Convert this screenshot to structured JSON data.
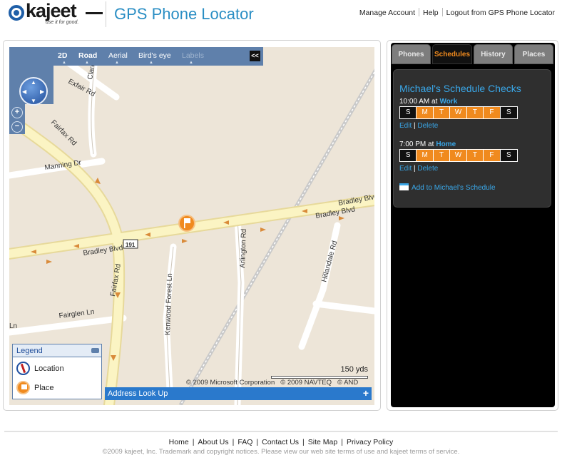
{
  "brand": {
    "logo_word": "kajeet",
    "logo_tagline": "use it for good.",
    "app_title": "GPS Phone Locator"
  },
  "top_links": [
    "Manage Account",
    "Help",
    "Logout from GPS Phone Locator"
  ],
  "map": {
    "toolbar": {
      "mode_2d": "2D",
      "road": "Road",
      "aerial": "Aerial",
      "birds_eye": "Bird's eye",
      "labels": "Labels",
      "collapse": "<<"
    },
    "street_labels": [
      "Exfair Rd",
      "Clarendon",
      "Fairfax Rd",
      "Manning Dr",
      "Bradley Blvd",
      "Bradley Blvd",
      "Bradley Blvd",
      "191",
      "Arlington Rd",
      "Hillandale Rd",
      "Fairfax Rd",
      "Kenwood Forest Ln",
      "Fairglen Ln",
      "Ln"
    ],
    "legend": {
      "title": "Legend",
      "items": [
        {
          "label": "Location",
          "icon": "location-marker-icon"
        },
        {
          "label": "Place",
          "icon": "place-flag-icon"
        }
      ]
    },
    "scale_label": "150 yds",
    "copyright": [
      "© 2009 Microsoft Corporation",
      "© 2009 NAVTEQ",
      "© AND"
    ],
    "address_lookup": "Address Look Up",
    "address_plus": "+"
  },
  "side": {
    "tabs": [
      {
        "label": "Phones",
        "active": false
      },
      {
        "label": "Schedules",
        "active": true
      },
      {
        "label": "History",
        "active": false
      },
      {
        "label": "Places",
        "active": false
      }
    ],
    "title": "Michael's Schedule Checks",
    "entries": [
      {
        "time": "10:00 AM at",
        "place": "Work",
        "days": [
          {
            "d": "S",
            "on": false
          },
          {
            "d": "M",
            "on": true
          },
          {
            "d": "T",
            "on": true
          },
          {
            "d": "W",
            "on": true
          },
          {
            "d": "T",
            "on": true
          },
          {
            "d": "F",
            "on": true
          },
          {
            "d": "S",
            "on": false
          }
        ],
        "edit": "Edit",
        "delete": "Delete"
      },
      {
        "time": "7:00 PM at",
        "place": "Home",
        "days": [
          {
            "d": "S",
            "on": false
          },
          {
            "d": "M",
            "on": true
          },
          {
            "d": "T",
            "on": true
          },
          {
            "d": "W",
            "on": true
          },
          {
            "d": "T",
            "on": true
          },
          {
            "d": "F",
            "on": true
          },
          {
            "d": "S",
            "on": false
          }
        ],
        "edit": "Edit",
        "delete": "Delete"
      }
    ],
    "add_label": "Add to Michael's Schedule",
    "colors": {
      "accent_orange": "#f08a1e",
      "link_blue": "#3aa7e8"
    }
  },
  "footer": {
    "links": [
      "Home",
      "About Us",
      "FAQ",
      "Contact Us",
      "Site Map",
      "Privacy Policy"
    ],
    "copyright": "©2009 kajeet, Inc. Trademark and copyright notices. Please view our web site terms of use and kajeet terms of service."
  }
}
